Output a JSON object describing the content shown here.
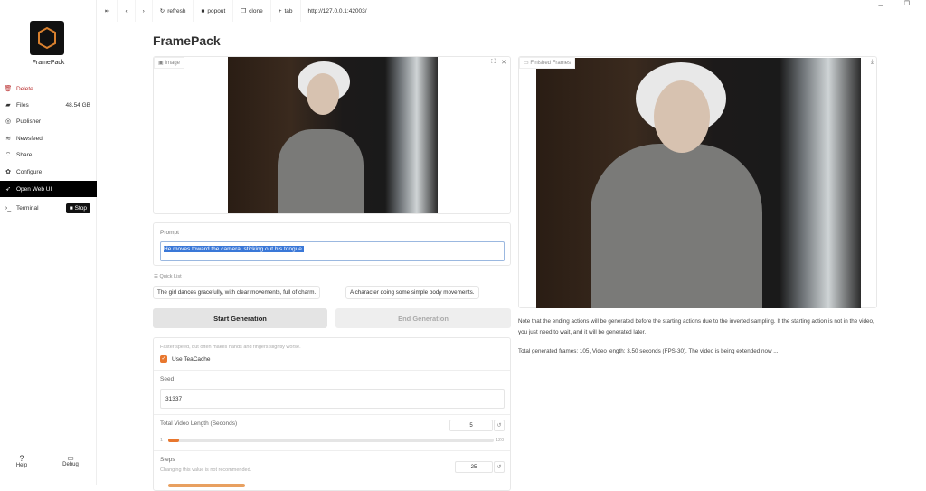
{
  "sidebar": {
    "app_name": "FramePack",
    "items": [
      {
        "label": "Delete",
        "icon": "trash-icon"
      },
      {
        "label": "Files",
        "icon": "folder-icon",
        "value": "48.54 GB"
      },
      {
        "label": "Publisher",
        "icon": "publisher-icon"
      },
      {
        "label": "Newsfeed",
        "icon": "rss-icon"
      },
      {
        "label": "Share",
        "icon": "wifi-icon"
      },
      {
        "label": "Configure",
        "icon": "gear-icon"
      },
      {
        "label": "Open Web UI",
        "icon": "rocket-icon"
      },
      {
        "label": "Terminal",
        "icon": "terminal-icon",
        "button": "Stop"
      }
    ],
    "help": "Help",
    "debug": "Debug"
  },
  "topbar": {
    "refresh": "refresh",
    "popout": "popout",
    "clone": "clone",
    "tab": "tab",
    "url": "http://127.0.0.1:42003/"
  },
  "main": {
    "title": "FramePack",
    "image_label": "Image",
    "prompt_label": "Prompt",
    "prompt_value": "He moves toward the camera, sticking out his tongue.",
    "quick_list_label": "Quick List",
    "quick_list": [
      "The girl dances gracefully, with clear movements, full of charm.",
      "A character doing some simple body movements."
    ],
    "start_button": "Start Generation",
    "end_button": "End Generation",
    "teacache_hint": "Faster speed, but often makes hands and fingers slightly worse.",
    "teacache_label": "Use TeaCache",
    "teacache_checked": true,
    "seed_label": "Seed",
    "seed_value": "31337",
    "length_label": "Total Video Length (Seconds)",
    "length_value": "5",
    "length_min": "1",
    "length_max": "120",
    "length_fraction": 0.034,
    "steps_label": "Steps",
    "steps_hint": "Changing this value is not recommended.",
    "steps_value": "25"
  },
  "output": {
    "label": "Finished Frames",
    "note": "Note that the ending actions will be generated before the starting actions due to the inverted sampling. If the starting action is not in the video, you just need to wait, and it will be generated later.",
    "status": "Total generated frames: 105, Video length: 3.50 seconds (FPS-30). The video is being extended now ..."
  },
  "colors": {
    "accent": "#e8772e",
    "selection": "#3a78d8"
  }
}
